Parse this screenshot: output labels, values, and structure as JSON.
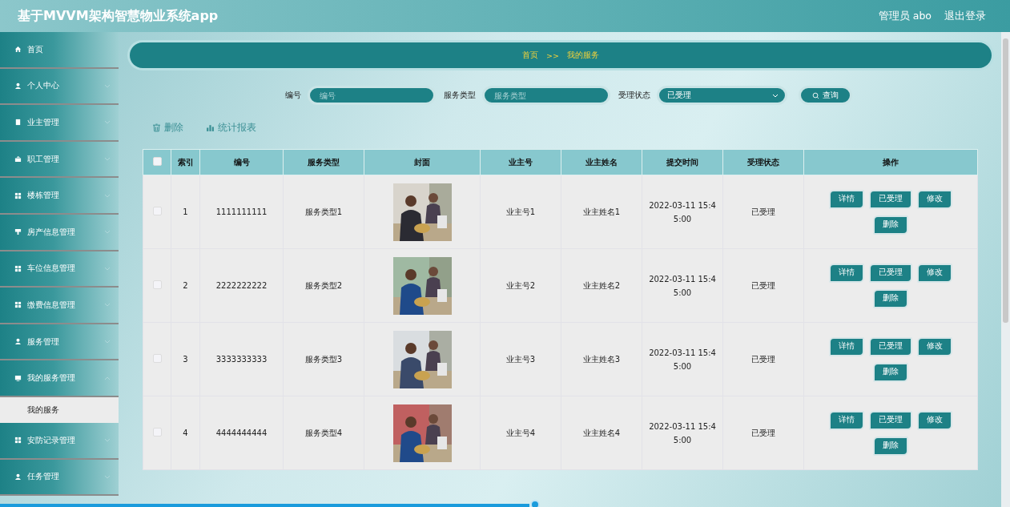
{
  "header": {
    "title": "基于MVVM架构智慧物业系统app",
    "user": "管理员 abo",
    "logout": "退出登录"
  },
  "sidebar": {
    "items": [
      {
        "label": "首页"
      },
      {
        "label": "个人中心",
        "expanded": false
      },
      {
        "label": "业主管理",
        "expanded": false
      },
      {
        "label": "职工管理",
        "expanded": false
      },
      {
        "label": "楼栋管理",
        "expanded": false
      },
      {
        "label": "房产信息管理",
        "expanded": false
      },
      {
        "label": "车位信息管理",
        "expanded": false
      },
      {
        "label": "缴费信息管理",
        "expanded": false
      },
      {
        "label": "服务管理",
        "expanded": false
      },
      {
        "label": "我的服务管理",
        "expanded": true,
        "children": [
          {
            "label": "我的服务",
            "selected": true
          }
        ]
      },
      {
        "label": "安防记录管理",
        "expanded": false
      },
      {
        "label": "任务管理",
        "expanded": false
      }
    ]
  },
  "breadcrumb": {
    "home": "首页",
    "separator": ">>",
    "current": "我的服务"
  },
  "search": {
    "fields": [
      {
        "kind": "input",
        "label": "编号",
        "placeholder": "编号"
      },
      {
        "kind": "input",
        "label": "服务类型",
        "placeholder": "服务类型"
      },
      {
        "kind": "select",
        "label": "受理状态",
        "value": "已受理"
      }
    ],
    "button": "查询"
  },
  "actions": [
    {
      "kind": "delete",
      "label": "删除"
    },
    {
      "kind": "chart",
      "label": "统计报表"
    }
  ],
  "table": {
    "all_checked": false,
    "columns": [
      "索引",
      "编号",
      "服务类型",
      "封面",
      "业主号",
      "业主姓名",
      "提交时间",
      "受理状态",
      "操作"
    ],
    "rows": [
      {
        "checked": false,
        "index": "1",
        "code": "1111111111",
        "type": "服务类型1",
        "owner_no": "业主号1",
        "owner_name": "业主姓名1",
        "time": "2022-03-11 15:45:00",
        "status": "已受理",
        "buttons": [
          "详情",
          "已受理",
          "修改",
          "删除"
        ]
      },
      {
        "checked": false,
        "index": "2",
        "code": "2222222222",
        "type": "服务类型2",
        "owner_no": "业主号2",
        "owner_name": "业主姓名2",
        "time": "2022-03-11 15:45:00",
        "status": "已受理",
        "buttons": [
          "详情",
          "已受理",
          "修改",
          "删除"
        ]
      },
      {
        "checked": false,
        "index": "3",
        "code": "3333333333",
        "type": "服务类型3",
        "owner_no": "业主号3",
        "owner_name": "业主姓名3",
        "time": "2022-03-11 15:45:00",
        "status": "已受理",
        "buttons": [
          "详情",
          "已受理",
          "修改",
          "删除"
        ]
      },
      {
        "checked": false,
        "index": "4",
        "code": "4444444444",
        "type": "服务类型4",
        "owner_no": "业主号4",
        "owner_name": "业主姓名4",
        "time": "2022-03-11 15:45:00",
        "status": "已受理",
        "buttons": [
          "详情",
          "已受理",
          "修改",
          "删除"
        ]
      }
    ]
  }
}
